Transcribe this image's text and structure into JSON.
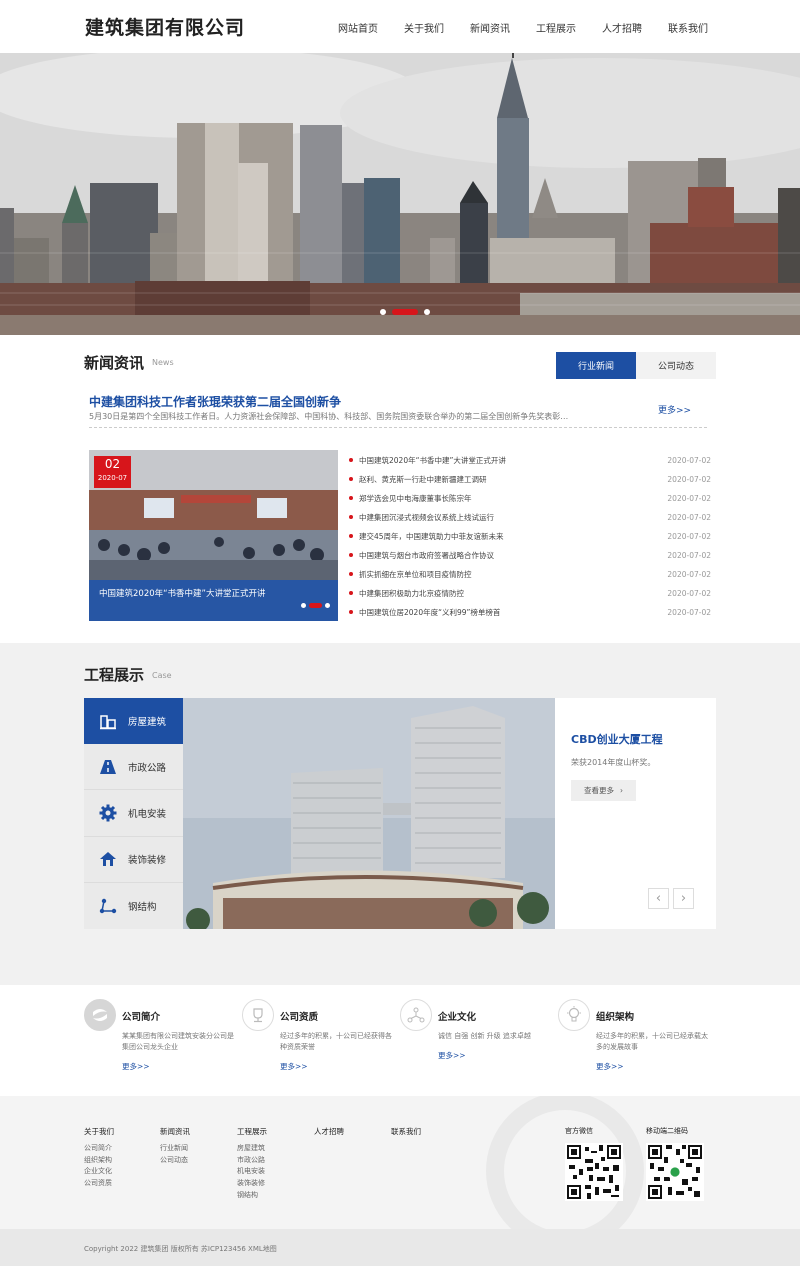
{
  "header": {
    "logo": "建筑集团有限公司",
    "nav": [
      "网站首页",
      "关于我们",
      "新闻资讯",
      "工程展示",
      "人才招聘",
      "联系我们"
    ]
  },
  "news": {
    "title": "新闻资讯",
    "subtitle": "News",
    "tabs": [
      "行业新闻",
      "公司动态"
    ],
    "headline": "中建集团科技工作者张琨荣获第二届全国创新争",
    "headline_desc": "5月30日是第四个全国科技工作者日。人力资源社会保障部、中国科协、科技部、国务院国资委联合举办的第二届全国创新争先奖表彰…",
    "more": "更多>>",
    "feature": {
      "day": "02",
      "year_month": "2020-07",
      "caption": "中国建筑2020年“书香中建”大讲堂正式开讲"
    },
    "items": [
      {
        "title": "中国建筑2020年“书香中建”大讲堂正式开讲",
        "date": "2020-07-02"
      },
      {
        "title": "赵利、黄克斯一行赴中建新疆建工调研",
        "date": "2020-07-02"
      },
      {
        "title": "郑学选会见中电海康董事长陈宗年",
        "date": "2020-07-02"
      },
      {
        "title": "中建集团沉浸式视频会议系统上线试运行",
        "date": "2020-07-02"
      },
      {
        "title": "建交45周年，中国建筑助力中菲友谊新未来",
        "date": "2020-07-02"
      },
      {
        "title": "中国建筑与烟台市政府签署战略合作协议",
        "date": "2020-07-02"
      },
      {
        "title": "抓实抓细在京单位和项目疫情防控",
        "date": "2020-07-02"
      },
      {
        "title": "中建集团积极助力北京疫情防控",
        "date": "2020-07-02"
      },
      {
        "title": "中国建筑位居2020年度“义利99”榜单榜首",
        "date": "2020-07-02"
      }
    ]
  },
  "cases": {
    "title": "工程展示",
    "subtitle": "Case",
    "menu": [
      {
        "label": "房屋建筑",
        "icon": "building-icon"
      },
      {
        "label": "市政公路",
        "icon": "road-icon"
      },
      {
        "label": "机电安装",
        "icon": "gear-icon"
      },
      {
        "label": "装饰装修",
        "icon": "house-icon"
      },
      {
        "label": "钢结构",
        "icon": "structure-icon"
      }
    ],
    "project_name": "CBD创业大厦工程",
    "project_desc": "荣获2014年度山杯奖。",
    "view_more": "查看更多",
    "prev": "‹",
    "next": "›"
  },
  "intro": [
    {
      "title": "公司简介",
      "desc": "某某集团有限公司建筑安装分公司是集团公司龙头企业",
      "more": "更多>>"
    },
    {
      "title": "公司资质",
      "desc": "经过多年的积累，十公司已经获得各种资质荣誉",
      "more": "更多>>"
    },
    {
      "title": "企业文化",
      "desc": "诚信 自强 创新 升级 追求卓越",
      "more": "更多>>"
    },
    {
      "title": "组织架构",
      "desc": "经过多年的积累，十公司已经承载太多的发展故事",
      "more": "更多>>"
    }
  ],
  "footer": {
    "columns": [
      {
        "title": "关于我们",
        "links": [
          "公司简介",
          "组织架构",
          "企业文化",
          "公司资质"
        ]
      },
      {
        "title": "新闻资讯",
        "links": [
          "行业新闻",
          "公司动态"
        ]
      },
      {
        "title": "工程展示",
        "links": [
          "房屋建筑",
          "市政公路",
          "机电安装",
          "装饰装修",
          "钢结构"
        ]
      },
      {
        "title": "人才招聘",
        "links": []
      },
      {
        "title": "联系我们",
        "links": []
      }
    ],
    "qr_labels": [
      "官方微信",
      "移动端二维码"
    ],
    "copyright": "Copyright 2022 建筑集团 版权所有 苏ICP123456 XML地图"
  },
  "colors": {
    "primary": "#1d4fa3",
    "accent": "#d7151b"
  }
}
